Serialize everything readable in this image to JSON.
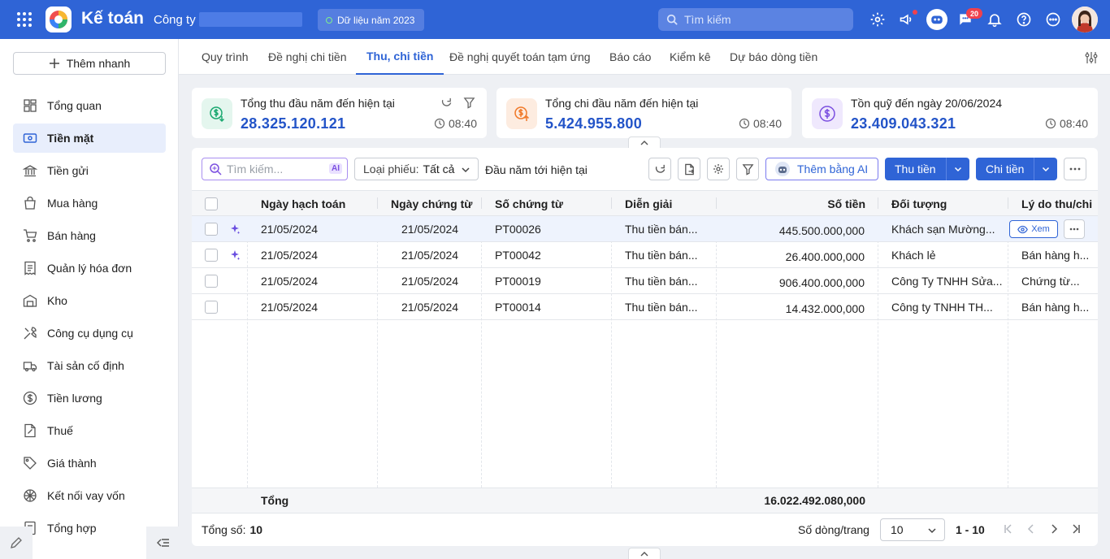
{
  "topbar": {
    "title": "Kế toán",
    "company": "Công ty",
    "year_chip": "Dữ liệu năm 2023",
    "search_placeholder": "Tìm kiếm",
    "chat_badge": "20"
  },
  "sidebar": {
    "quick_add": "Thêm nhanh",
    "items": [
      {
        "label": "Tổng quan",
        "icon": "dashboard-icon"
      },
      {
        "label": "Tiền mặt",
        "icon": "cash-icon"
      },
      {
        "label": "Tiền gửi",
        "icon": "bank-icon"
      },
      {
        "label": "Mua hàng",
        "icon": "shopping-bag-icon"
      },
      {
        "label": "Bán hàng",
        "icon": "cart-icon"
      },
      {
        "label": "Quản lý hóa đơn",
        "icon": "invoice-icon"
      },
      {
        "label": "Kho",
        "icon": "warehouse-icon"
      },
      {
        "label": "Công cụ dụng cụ",
        "icon": "tools-icon"
      },
      {
        "label": "Tài sản cố định",
        "icon": "truck-icon"
      },
      {
        "label": "Tiền lương",
        "icon": "dollar-circle-icon"
      },
      {
        "label": "Thuế",
        "icon": "tax-document-icon"
      },
      {
        "label": "Giá thành",
        "icon": "price-tag-icon"
      },
      {
        "label": "Kết nối vay vốn",
        "icon": "loan-link-icon"
      },
      {
        "label": "Tổng hợp",
        "icon": "summary-icon"
      }
    ],
    "active_index": 1
  },
  "tabs": {
    "items": [
      "Quy trình",
      "Đề nghị chi tiền",
      "Thu, chi tiền",
      "Đề nghị quyết toán tạm ứng",
      "Báo cáo",
      "Kiểm kê",
      "Dự báo dòng tiền"
    ],
    "active_index": 2
  },
  "cards": [
    {
      "label": "Tổng thu đầu năm đến hiện tại",
      "value": "28.325.120.121",
      "time": "08:40",
      "color": "#1aa870"
    },
    {
      "label": "Tổng chi đầu năm đến hiện tại",
      "value": "5.424.955.800",
      "time": "08:40",
      "color": "#f07a2a"
    },
    {
      "label": "Tồn quỹ đến ngày 20/06/2024",
      "value": "23.409.043.321",
      "time": "08:40",
      "color": "#7b4fe0"
    }
  ],
  "toolbar": {
    "search_placeholder": "Tìm kiếm...",
    "ai_tag": "AI",
    "type_label": "Loại phiếu:",
    "type_value": "Tất cả",
    "period": "Đầu năm tới hiện tại",
    "ai_button": "Thêm bằng AI",
    "receive_button": "Thu tiền",
    "pay_button": "Chi tiền"
  },
  "table": {
    "headers": [
      "Ngày hạch toán",
      "Ngày chứng từ",
      "Số chứng từ",
      "Diễn giải",
      "Số tiền",
      "Đối tượng",
      "Lý do thu/chi"
    ],
    "rows": [
      {
        "ai": true,
        "date": "21/05/2024",
        "doc_date": "21/05/2024",
        "doc_no": "PT00026",
        "desc": "Thu tiền bán...",
        "amount": "445.500.000,000",
        "party": "Khách sạn Mường...",
        "reason": ""
      },
      {
        "ai": true,
        "date": "21/05/2024",
        "doc_date": "21/05/2024",
        "doc_no": "PT00042",
        "desc": "Thu tiền bán...",
        "amount": "26.400.000,000",
        "party": "Khách lẻ",
        "reason": "Bán hàng h..."
      },
      {
        "ai": false,
        "date": "21/05/2024",
        "doc_date": "21/05/2024",
        "doc_no": "PT00019",
        "desc": "Thu tiền bán...",
        "amount": "906.400.000,000",
        "party": "Công Ty TNHH Sửa...",
        "reason": "Chứng từ..."
      },
      {
        "ai": false,
        "date": "21/05/2024",
        "doc_date": "21/05/2024",
        "doc_no": "PT00014",
        "desc": "Thu tiền bán...",
        "amount": "14.432.000,000",
        "party": "Công ty TNHH TH...",
        "reason": "Bán hàng h..."
      }
    ],
    "view_label": "Xem",
    "total_label": "Tổng",
    "total_amount": "16.022.492.080,000"
  },
  "footer": {
    "count_label": "Tổng số:",
    "count_value": "10",
    "rows_per_page_label": "Số dòng/trang",
    "rows_per_page": "10",
    "range": "1 - 10"
  }
}
